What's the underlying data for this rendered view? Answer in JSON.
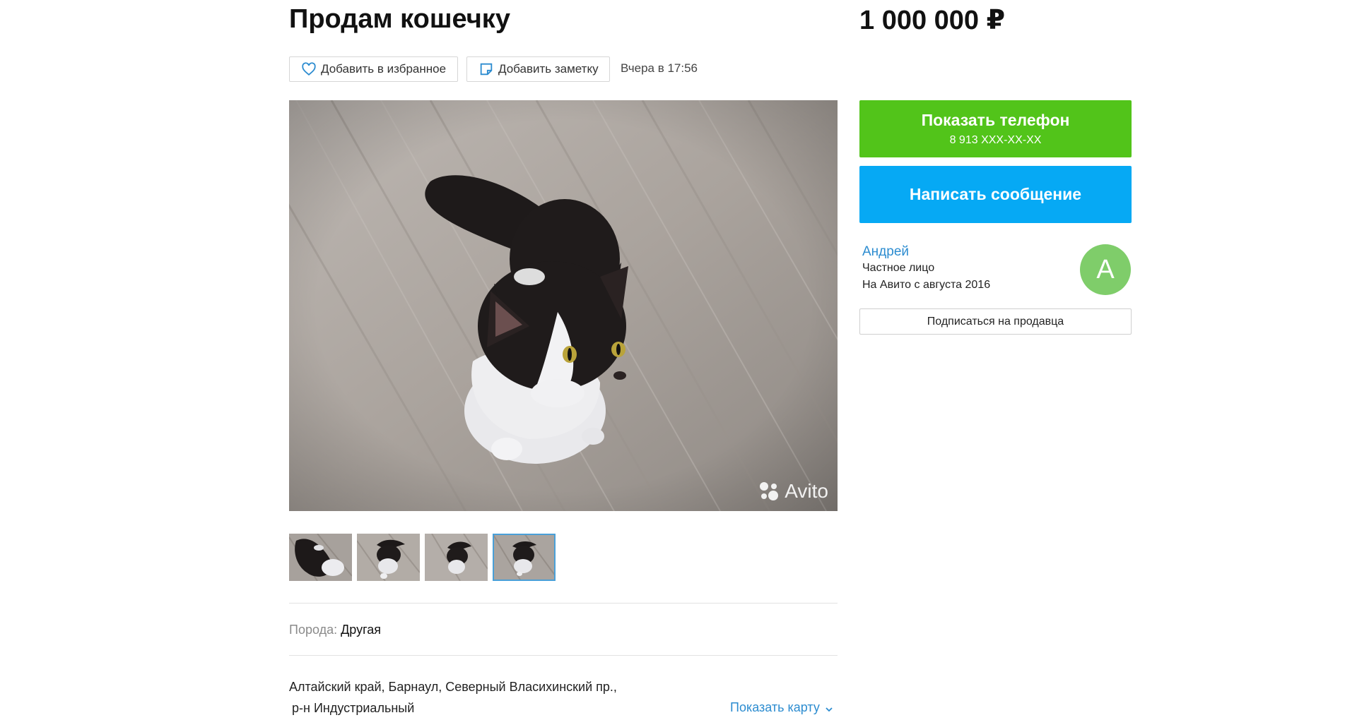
{
  "listing": {
    "title": "Продам кошечку",
    "price": "1 000 000 ₽",
    "date": "Вчера в 17:56"
  },
  "actions": {
    "favorite_label": "Добавить в избранное",
    "note_label": "Добавить заметку"
  },
  "gallery": {
    "watermark": "Avito",
    "thumbnail_count": 4,
    "active_thumbnail": 4
  },
  "params": {
    "breed_label": "Порода:",
    "breed_value": "Другая"
  },
  "location": {
    "line1": "Алтайский край, Барнаул, Северный Власихинский пр.,",
    "line2": "р-н Индустриальный",
    "map_link": "Показать карту"
  },
  "contact": {
    "phone_button": "Показать телефон",
    "phone_masked": "8 913 XXX-XX-XX",
    "message_button": "Написать сообщение"
  },
  "seller": {
    "name": "Андрей",
    "type": "Частное лицо",
    "since": "На Авито с августа 2016",
    "avatar_letter": "А",
    "subscribe_button": "Подписаться на продавца"
  },
  "colors": {
    "phone_button": "#52c41a",
    "message_button": "#06a9f4",
    "link": "#2c8cd0",
    "avatar": "#7fcd6a"
  },
  "icons": {
    "favorite": "heart-icon",
    "note": "note-icon",
    "map_toggle": "chevron-down-icon",
    "watermark": "avito-logo-icon"
  }
}
